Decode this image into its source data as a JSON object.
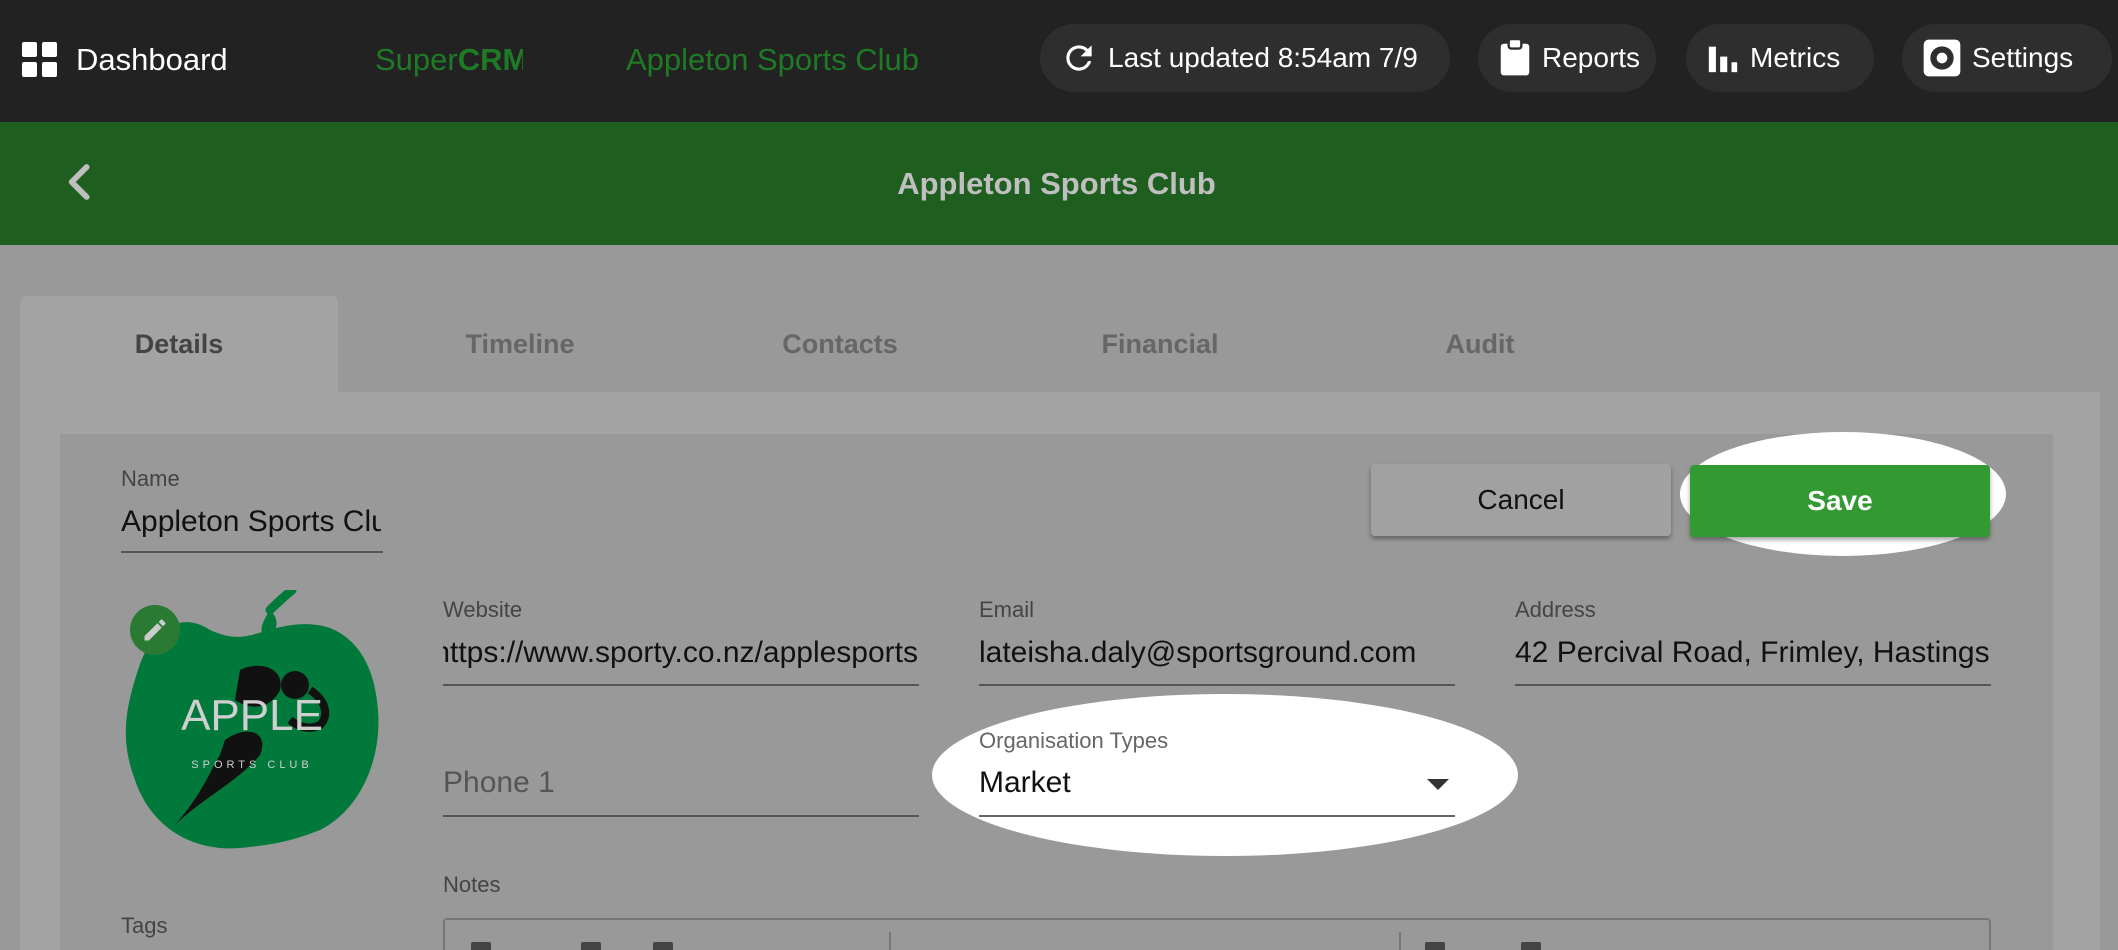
{
  "topbar": {
    "dashboard_label": "Dashboard",
    "brand_prefix": "Super",
    "brand_bold": "CRM",
    "org_title": "Appleton Sports Club",
    "last_updated": "Last updated 8:54am 7/9",
    "reports_label": "Reports",
    "metrics_label": "Metrics",
    "settings_label": "Settings"
  },
  "header": {
    "title": "Appleton Sports Club"
  },
  "tabs": [
    {
      "label": "Details",
      "active": true
    },
    {
      "label": "Timeline"
    },
    {
      "label": "Contacts"
    },
    {
      "label": "Financial"
    },
    {
      "label": "Audit"
    }
  ],
  "form": {
    "name_label": "Name",
    "name_value": "Appleton Sports Club",
    "cancel_label": "Cancel",
    "save_label": "Save",
    "website_label": "Website",
    "website_value": "https://www.sporty.co.nz/applesports",
    "email_label": "Email",
    "email_value": "lateisha.daly@sportsground.com",
    "address_label": "Address",
    "address_value": "42 Percival Road, Frimley, Hastings",
    "phone_placeholder": "Phone 1",
    "org_types_label": "Organisation Types",
    "org_types_value": "Market",
    "notes_label": "Notes",
    "tags_label": "Tags"
  },
  "logo": {
    "title": "APPLE",
    "subtitle": "SPORTS CLUB"
  },
  "colors": {
    "topbar_bg": "#222222",
    "header_bg": "#1e5e1f",
    "brand_green": "#1f7a25",
    "save_green": "#339933",
    "logo_green": "#00793a"
  }
}
